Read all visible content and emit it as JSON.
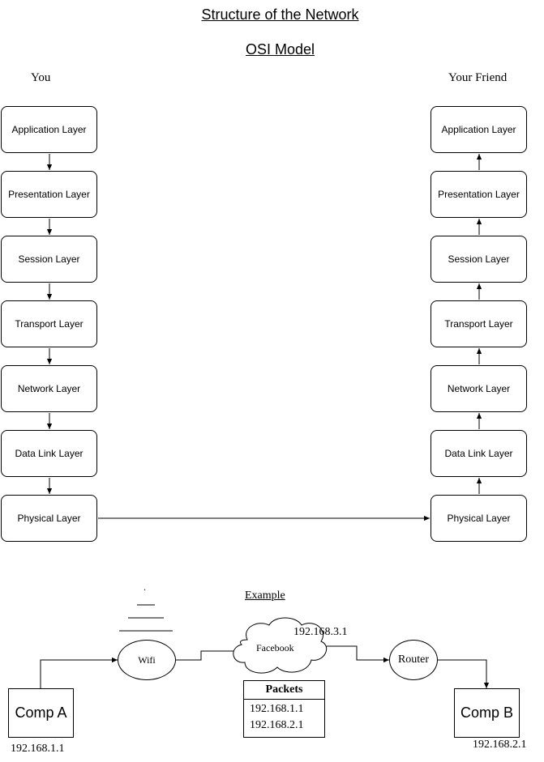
{
  "title": "Structure of the Network",
  "subtitle": "OSI Model",
  "left_column": {
    "header": "You",
    "layers": [
      "Application Layer",
      "Presentation Layer",
      "Session Layer",
      "Transport Layer",
      "Network Layer",
      "Data Link Layer",
      "Physical Layer"
    ]
  },
  "right_column": {
    "header": "Your Friend",
    "layers": [
      "Application Layer",
      "Presentation Layer",
      "Session Layer",
      "Transport Layer",
      "Network Layer",
      "Data Link Layer",
      "Physical Layer"
    ]
  },
  "example": {
    "heading": "Example",
    "wifi_dot": ".",
    "comp_a": "Comp A",
    "comp_a_ip": "192.168.1.1",
    "wifi": "Wifi",
    "facebook": "Facebook",
    "facebook_ip": "192.168.3.1",
    "router": "Router",
    "comp_b": "Comp B",
    "comp_b_ip": "192.168.2.1",
    "packets": {
      "header": "Packets",
      "rows": [
        "192.168.1.1",
        "192.168.2.1"
      ]
    }
  }
}
